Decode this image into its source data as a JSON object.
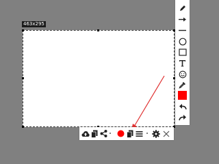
{
  "selection": {
    "size_label": "463x295"
  },
  "vertical_toolbar": {
    "tools": [
      "pencil-icon",
      "arrow-icon",
      "line-icon",
      "ellipse-icon",
      "rectangle-icon",
      "text-icon",
      "emoji-icon",
      "color-picker-icon",
      "color-swatch",
      "undo-icon",
      "redo-icon"
    ],
    "active_color": "#ff0000"
  },
  "horizontal_toolbar": {
    "tools": [
      "cloud-upload-icon",
      "copy-icon",
      "share-icon",
      "record-icon",
      "copy-icon",
      "menu-icon",
      "settings-icon",
      "close-icon"
    ],
    "record_color": "#ff0000"
  },
  "annotation": {
    "arrow_color": "#e03030"
  }
}
